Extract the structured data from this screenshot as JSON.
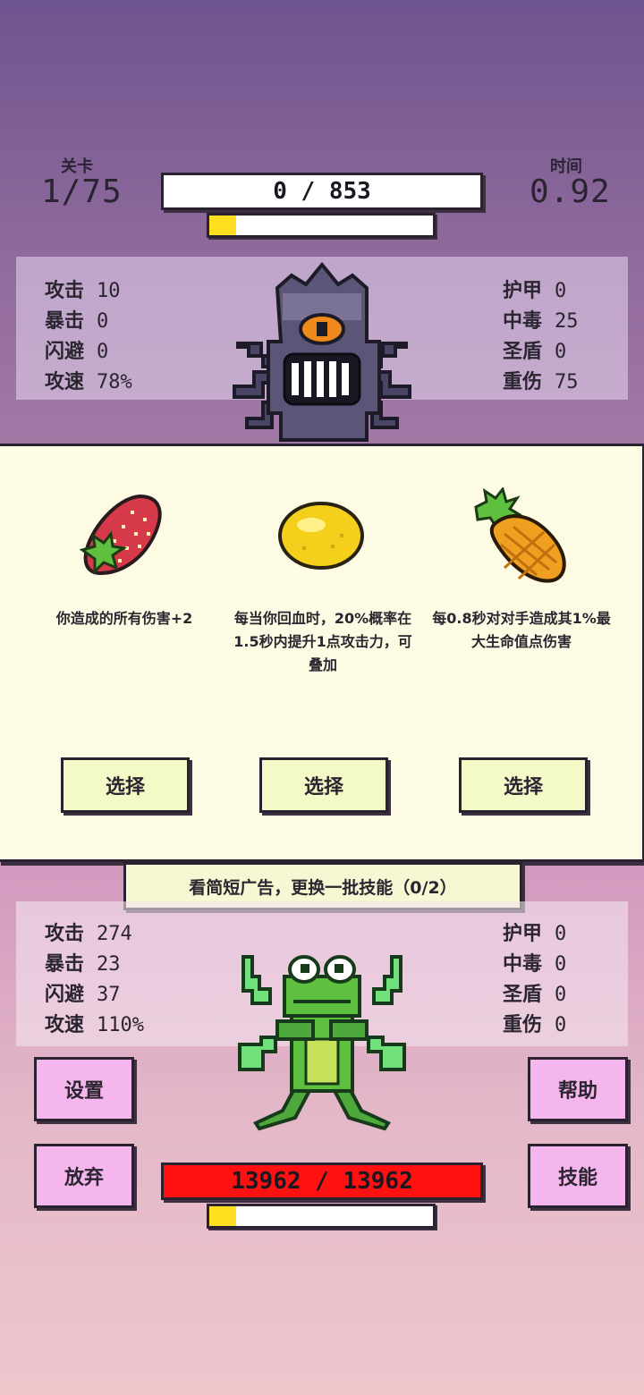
{
  "hud": {
    "level_label": "关卡",
    "level_value": "1/75",
    "time_label": "时间",
    "time_value": "0.92",
    "enemy_hp_text": "0 / 853",
    "enemy_charge_fraction": 0.12
  },
  "enemy": {
    "sprite": "one-eyed-spider-monster",
    "stats_left": [
      {
        "label": "攻击",
        "value": "10"
      },
      {
        "label": "暴击",
        "value": "0"
      },
      {
        "label": "闪避",
        "value": "0"
      },
      {
        "label": "攻速",
        "value": "78%"
      }
    ],
    "stats_right": [
      {
        "label": "护甲",
        "value": "0"
      },
      {
        "label": "中毒",
        "value": "25"
      },
      {
        "label": "圣盾",
        "value": "0"
      },
      {
        "label": "重伤",
        "value": "75"
      }
    ]
  },
  "choices": [
    {
      "icon": "strawberry-icon",
      "description": "你造成的所有伤害+2",
      "button": "选择"
    },
    {
      "icon": "lemon-icon",
      "description": "每当你回血时，20%概率在1.5秒内提升1点攻击力，可叠加",
      "button": "选择"
    },
    {
      "icon": "pineapple-icon",
      "description": "每0.8秒对对手造成其1%最大生命值点伤害",
      "button": "选择"
    }
  ],
  "ad_banner": "看简短广告，更换一批技能（0/2）",
  "player": {
    "sprite": "frog-warrior",
    "hp_text": "13962 / 13962",
    "charge_fraction": 0.12,
    "stats_left": [
      {
        "label": "攻击",
        "value": "274"
      },
      {
        "label": "暴击",
        "value": "23"
      },
      {
        "label": "闪避",
        "value": "37"
      },
      {
        "label": "攻速",
        "value": "110%"
      }
    ],
    "stats_right": [
      {
        "label": "护甲",
        "value": "0"
      },
      {
        "label": "中毒",
        "value": "0"
      },
      {
        "label": "圣盾",
        "value": "0"
      },
      {
        "label": "重伤",
        "value": "0"
      }
    ]
  },
  "buttons": {
    "settings": "设置",
    "help": "帮助",
    "give_up": "放弃",
    "skills": "技能"
  },
  "colors": {
    "hp_bar": "#ff1111",
    "charge": "#ffe021",
    "side_button": "#f5b6ee",
    "choice_panel": "#fdfbe3"
  }
}
